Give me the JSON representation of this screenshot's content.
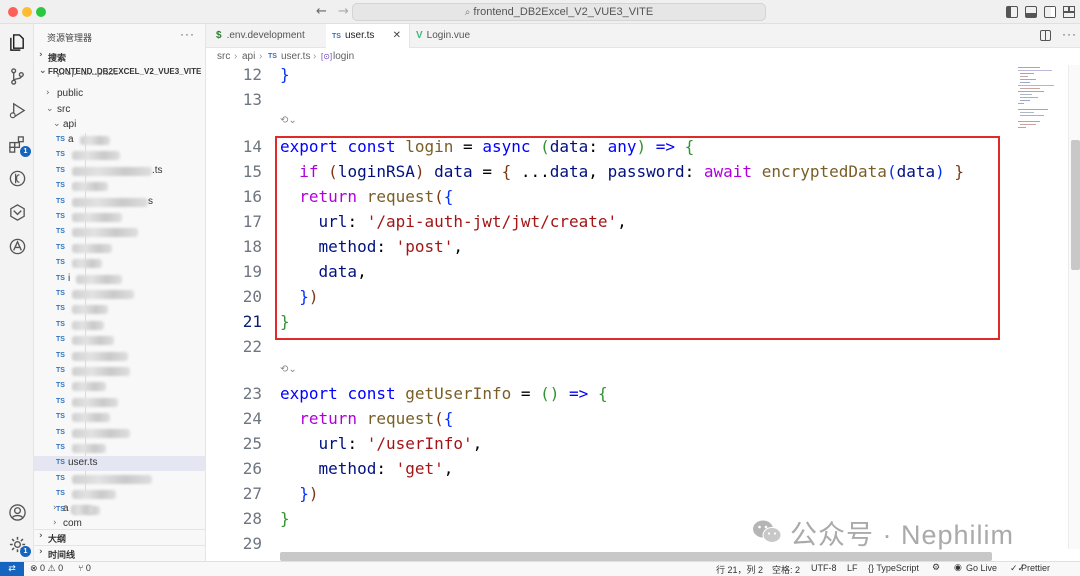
{
  "window": {
    "command_center": "frontend_DB2Excel_V2_VUE3_VITE",
    "back_arrow": "←",
    "forward_arrow": "→"
  },
  "sidebar": {
    "title": "资源管理器",
    "more": "···",
    "search_section": "搜索",
    "project_section": "FRONTEND_DB2EXCEL_V2_VUE3_VITE",
    "tree": {
      "prop_template": "prop-template",
      "public": "public",
      "src": "src",
      "api": "api",
      "visible_file_fragments": [
        "a",
        ".ts",
        "s",
        "i",
        "user.ts",
        "a",
        "com"
      ],
      "ts_tag": "TS",
      "active_file": "user.ts"
    },
    "outline_section": "大纲",
    "timeline_section": "时间线"
  },
  "activity": {
    "extensions_badge": "1",
    "settings_badge": "1"
  },
  "tabs": [
    {
      "icon": "$",
      "label": ".env.development",
      "active": false
    },
    {
      "icon": "TS",
      "label": "user.ts",
      "active": true
    },
    {
      "icon": "V",
      "label": "Login.vue",
      "active": false
    }
  ],
  "tab_close": "✕",
  "breadcrumb": {
    "parts": [
      "src",
      "›",
      "api",
      "›",
      "TS",
      "user.ts",
      "›",
      "login"
    ]
  },
  "editor": {
    "lines": [
      {
        "num": "12",
        "tokens": [
          [
            "b1",
            "}"
          ]
        ]
      },
      {
        "num": "13",
        "tokens": []
      },
      {
        "num": "14",
        "tokens": [
          [
            "k",
            "export"
          ],
          [
            "p",
            " "
          ],
          [
            "k",
            "const"
          ],
          [
            "p",
            " "
          ],
          [
            "f",
            "login"
          ],
          [
            "p",
            " = "
          ],
          [
            "k",
            "async"
          ],
          [
            "p",
            " "
          ],
          [
            "b2",
            "("
          ],
          [
            "v",
            "data"
          ],
          [
            "p",
            ": "
          ],
          [
            "k",
            "any"
          ],
          [
            "b2",
            ")"
          ],
          [
            "p",
            " "
          ],
          [
            "k",
            "=>"
          ],
          [
            "p",
            " "
          ],
          [
            "b2",
            "{"
          ]
        ]
      },
      {
        "num": "15",
        "tokens": [
          [
            "p",
            "  "
          ],
          [
            "ctrl",
            "if"
          ],
          [
            "p",
            " "
          ],
          [
            "b3",
            "("
          ],
          [
            "v",
            "loginRSA"
          ],
          [
            "b3",
            ")"
          ],
          [
            "p",
            " "
          ],
          [
            "v",
            "data"
          ],
          [
            "p",
            " = "
          ],
          [
            "b3",
            "{"
          ],
          [
            "p",
            " ..."
          ],
          [
            "v",
            "data"
          ],
          [
            "p",
            ", "
          ],
          [
            "v",
            "password"
          ],
          [
            "p",
            ": "
          ],
          [
            "ctrl",
            "await"
          ],
          [
            "p",
            " "
          ],
          [
            "f",
            "encryptedData"
          ],
          [
            "b1",
            "("
          ],
          [
            "v",
            "data"
          ],
          [
            "b1",
            ")"
          ],
          [
            "p",
            " "
          ],
          [
            "b3",
            "}"
          ]
        ]
      },
      {
        "num": "16",
        "tokens": [
          [
            "p",
            "  "
          ],
          [
            "ctrl",
            "return"
          ],
          [
            "p",
            " "
          ],
          [
            "f",
            "request"
          ],
          [
            "b3",
            "("
          ],
          [
            "b1",
            "{"
          ]
        ]
      },
      {
        "num": "17",
        "tokens": [
          [
            "p",
            "    "
          ],
          [
            "v",
            "url"
          ],
          [
            "p",
            ": "
          ],
          [
            "s",
            "'/api-auth-jwt/jwt/create'"
          ],
          [
            "p",
            ","
          ]
        ]
      },
      {
        "num": "18",
        "tokens": [
          [
            "p",
            "    "
          ],
          [
            "v",
            "method"
          ],
          [
            "p",
            ": "
          ],
          [
            "s",
            "'post'"
          ],
          [
            "p",
            ","
          ]
        ]
      },
      {
        "num": "19",
        "tokens": [
          [
            "p",
            "    "
          ],
          [
            "v",
            "data"
          ],
          [
            "p",
            ","
          ]
        ]
      },
      {
        "num": "20",
        "tokens": [
          [
            "p",
            "  "
          ],
          [
            "b1",
            "}"
          ],
          [
            "b3",
            ")"
          ]
        ]
      },
      {
        "num": "21",
        "tokens": [
          [
            "b2",
            "}"
          ]
        ],
        "current": true
      },
      {
        "num": "22",
        "tokens": []
      },
      {
        "num": "23",
        "tokens": [
          [
            "k",
            "export"
          ],
          [
            "p",
            " "
          ],
          [
            "k",
            "const"
          ],
          [
            "p",
            " "
          ],
          [
            "f",
            "getUserInfo"
          ],
          [
            "p",
            " = "
          ],
          [
            "b2",
            "()"
          ],
          [
            "p",
            " "
          ],
          [
            "k",
            "=>"
          ],
          [
            "p",
            " "
          ],
          [
            "b2",
            "{"
          ]
        ]
      },
      {
        "num": "24",
        "tokens": [
          [
            "p",
            "  "
          ],
          [
            "ctrl",
            "return"
          ],
          [
            "p",
            " "
          ],
          [
            "f",
            "request"
          ],
          [
            "b3",
            "("
          ],
          [
            "b1",
            "{"
          ]
        ]
      },
      {
        "num": "25",
        "tokens": [
          [
            "p",
            "    "
          ],
          [
            "v",
            "url"
          ],
          [
            "p",
            ": "
          ],
          [
            "s",
            "'/userInfo'"
          ],
          [
            "p",
            ","
          ]
        ]
      },
      {
        "num": "26",
        "tokens": [
          [
            "p",
            "    "
          ],
          [
            "v",
            "method"
          ],
          [
            "p",
            ": "
          ],
          [
            "s",
            "'get'"
          ],
          [
            "p",
            ","
          ]
        ]
      },
      {
        "num": "27",
        "tokens": [
          [
            "p",
            "  "
          ],
          [
            "b1",
            "}"
          ],
          [
            "b3",
            ")"
          ]
        ]
      },
      {
        "num": "28",
        "tokens": [
          [
            "b2",
            "}"
          ]
        ]
      },
      {
        "num": "29",
        "tokens": []
      }
    ]
  },
  "statusbar": {
    "remote": "⇄",
    "errors": "⊗ 0 ⚠ 0",
    "ports": "⑂ 0",
    "position": "行 21，列 2",
    "spaces": "空格: 2",
    "encoding": "UTF-8",
    "eol": "LF",
    "language": "{} TypeScript",
    "golive": "Go Live",
    "prettier": "Prettier"
  },
  "watermark": {
    "text": "公众号 · Nephilim"
  },
  "colors": {
    "highlight_box": "#e02a2a",
    "accent": "#1565c0",
    "active_file_bg": "#e4e6f1"
  }
}
